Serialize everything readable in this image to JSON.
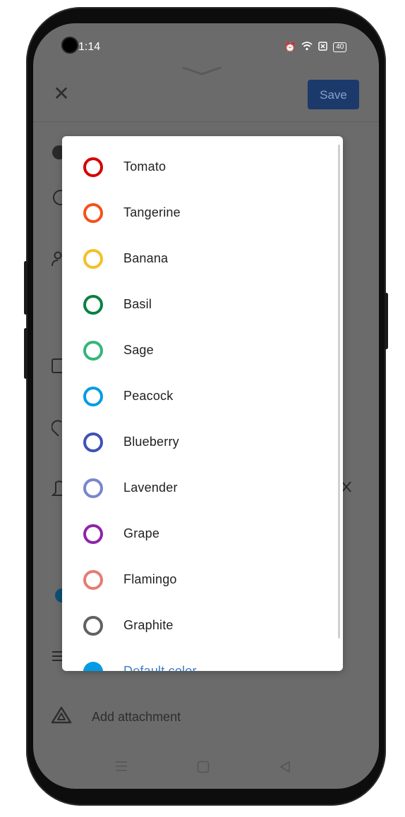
{
  "status_bar": {
    "time": "1:14",
    "battery": "40"
  },
  "toolbar": {
    "save_label": "Save"
  },
  "background": {
    "attachment_label": "Add attachment"
  },
  "color_picker": {
    "options": [
      {
        "label": "Tomato",
        "color": "#d50000"
      },
      {
        "label": "Tangerine",
        "color": "#f4511e"
      },
      {
        "label": "Banana",
        "color": "#f6bf26"
      },
      {
        "label": "Basil",
        "color": "#0b8043"
      },
      {
        "label": "Sage",
        "color": "#33b679"
      },
      {
        "label": "Peacock",
        "color": "#039be5"
      },
      {
        "label": "Blueberry",
        "color": "#3f51b5"
      },
      {
        "label": "Lavender",
        "color": "#7986cb"
      },
      {
        "label": "Grape",
        "color": "#8e24aa"
      },
      {
        "label": "Flamingo",
        "color": "#e67c73"
      },
      {
        "label": "Graphite",
        "color": "#616161"
      },
      {
        "label": "Default color",
        "color": "#039be5"
      }
    ]
  }
}
